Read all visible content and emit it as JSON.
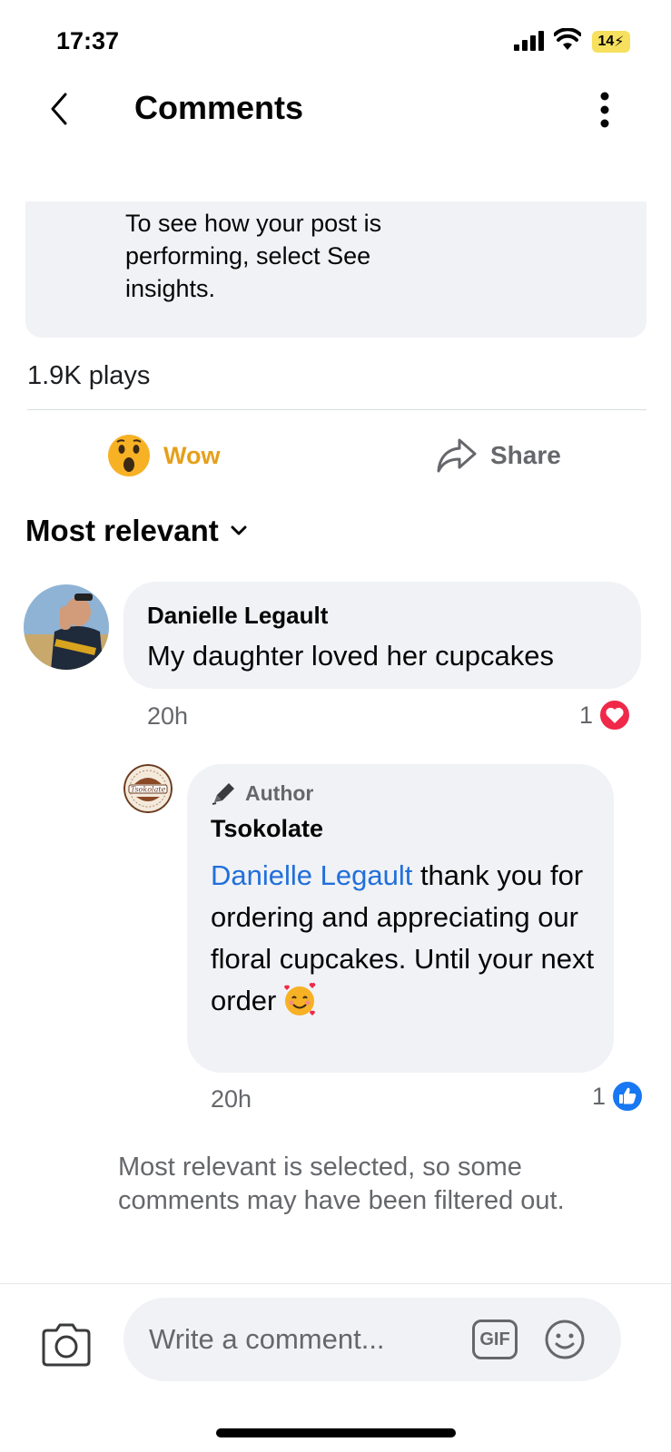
{
  "status_bar": {
    "time": "17:37",
    "battery": "14"
  },
  "header": {
    "title": "Comments"
  },
  "insights": {
    "text": "To see how your post is performing, select See insights."
  },
  "stats": {
    "plays": "1.9K plays"
  },
  "actions": {
    "reaction_label": "Wow",
    "share_label": "Share"
  },
  "sort": {
    "label": "Most relevant"
  },
  "comments": [
    {
      "author": "Danielle Legault",
      "text": "My daughter loved her cupcakes",
      "time": "20h",
      "reaction_count": "1",
      "reaction_icon": "heart-icon"
    }
  ],
  "reply": {
    "badge": "Author",
    "author": "Tsokolate",
    "mention": "Danielle Legault",
    "text": " thank you for ordering and appreciating our floral cupcakes. Until your next order",
    "time": "20h",
    "reaction_count": "1",
    "reaction_icon": "like-icon",
    "avatar_text": "Tsokolate"
  },
  "filter_note": "Most relevant is selected, so some comments may have been filtered out.",
  "composer": {
    "placeholder": "Write a comment...",
    "gif_label": "GIF"
  },
  "colors": {
    "accent": "#216fdb",
    "wow": "#e5a01a",
    "heart": "#f02849",
    "like": "#1877f2",
    "bubble": "#f0f2f5"
  }
}
